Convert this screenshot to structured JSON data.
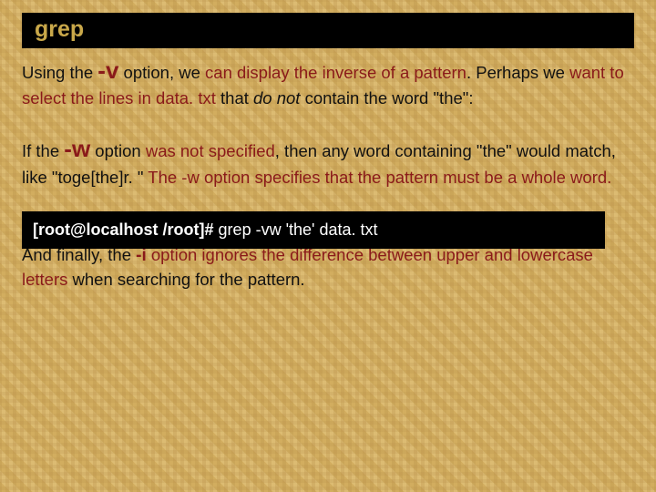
{
  "title": "grep",
  "p1": {
    "t1": "Using the ",
    "opt": "-v",
    "t2": " option, we ",
    "t3": "can display the inverse of a pattern",
    "t4": ". Perhaps we ",
    "t5": "want to select the lines in data. txt",
    "t6": " that ",
    "donot": "do not",
    "t7": " contain the word \"the\":"
  },
  "p2": {
    "t1": "If the ",
    "opt": "-w",
    "t2": " option ",
    "t3": "was not specified",
    "t4": ", then any word containing \"the\" would match, like \"toge[the]r. \" ",
    "t5": "The -w option specifies that the pattern must be a whole word."
  },
  "terminal": {
    "prompt": "[root@localhost /root]#",
    "cmd": " grep -vw 'the' data. txt"
  },
  "p3": {
    "t1": "And finally, the ",
    "opt": "-i",
    "t2": " option ignores the difference between upper and lowercase letters",
    "t3": " when searching for the pattern."
  }
}
